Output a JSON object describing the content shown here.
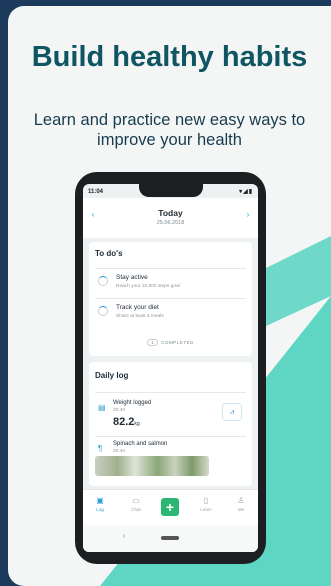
{
  "headline": "Build healthy habits",
  "subline": "Learn and practice new easy ways to improve your health",
  "colors": {
    "teal": "#5fd6c4",
    "navy": "#1b3a5c",
    "accent": "#2a9fd6",
    "plus": "#2bb673"
  },
  "status": {
    "time": "11:04",
    "icons": "▾◢▮"
  },
  "date": {
    "title": "Today",
    "subtitle": "25.06.2018",
    "prev_icon": "chevron-left-icon",
    "next_icon": "chevron-right-icon"
  },
  "todos": {
    "title": "To do's",
    "items": [
      {
        "title": "Stay active",
        "subtitle": "Reach your 10,000 steps goal"
      },
      {
        "title": "Track your diet",
        "subtitle": "Share at least 3 meals"
      }
    ],
    "completed_count": "1",
    "completed_label": "COMPLETED"
  },
  "daily_log": {
    "title": "Daily log",
    "items": [
      {
        "title": "Weight logged",
        "time": "20:40",
        "value": "82.2",
        "unit": "kg",
        "icon": "scale-icon"
      },
      {
        "title": "Spinach and salmon",
        "time": "20:40",
        "icon": "fork-knife-icon"
      }
    ]
  },
  "tabs": [
    {
      "label": "Log",
      "icon": "log-icon",
      "active": true
    },
    {
      "label": "Chat",
      "icon": "chat-icon",
      "active": false
    },
    {
      "label": "",
      "icon": "plus-icon",
      "active": false
    },
    {
      "label": "Learn",
      "icon": "book-icon",
      "active": false
    },
    {
      "label": "Me",
      "icon": "person-icon",
      "active": false
    }
  ]
}
